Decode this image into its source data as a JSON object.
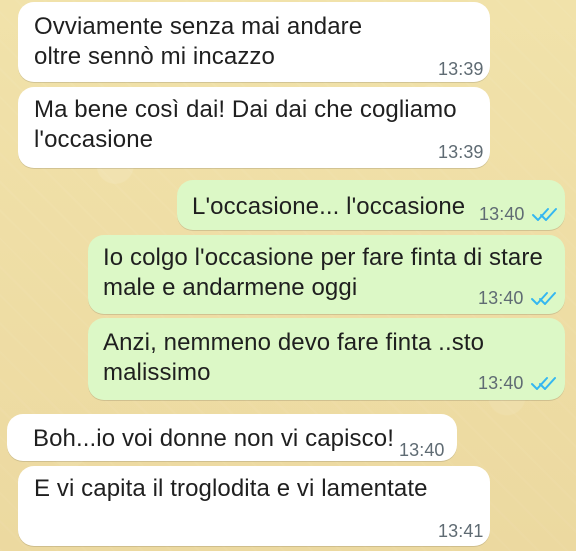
{
  "chat": {
    "messages": [
      {
        "side": "incoming",
        "text": "Ovviamente senza mai andare oltre sennò mi incazzo",
        "time": "13:39"
      },
      {
        "side": "incoming",
        "text": "Ma bene così dai! Dai dai che cogliamo l'occasione",
        "time": "13:39"
      },
      {
        "side": "outgoing",
        "text": "L'occasione... l'occasione",
        "time": "13:40",
        "status_icon": "double-check-icon"
      },
      {
        "side": "outgoing",
        "text": "Io colgo l'occasione per fare finta di stare male e andarmene oggi",
        "time": "13:40",
        "status_icon": "double-check-icon"
      },
      {
        "side": "outgoing",
        "text": "Anzi, nemmeno devo fare finta ..sto malissimo",
        "time": "13:40",
        "status_icon": "double-check-icon"
      },
      {
        "side": "incoming",
        "text": "Boh...io voi donne non vi capisco!",
        "time": "13:40"
      },
      {
        "side": "incoming",
        "text": "E vi capita il troglodita e vi lamentate",
        "time": "13:41"
      }
    ]
  },
  "colors": {
    "wallpaper": "#efdfa6",
    "incoming_bubble": "#ffffff",
    "outgoing_bubble": "#dcf8c6",
    "read_check": "#34b7f1",
    "timestamp": "#5f6b73"
  }
}
